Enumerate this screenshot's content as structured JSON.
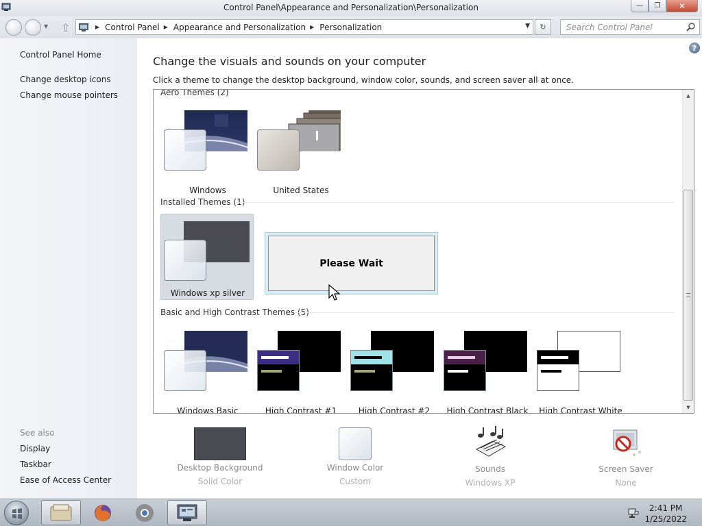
{
  "window": {
    "title": "Control Panel\\Appearance and Personalization\\Personalization",
    "minimize_glyph": "—",
    "maximize_glyph": "❐",
    "close_glyph": "✕"
  },
  "nav": {
    "breadcrumb": [
      "Control Panel",
      "Appearance and Personalization",
      "Personalization"
    ],
    "search_placeholder": "Search Control Panel"
  },
  "sidebar": {
    "links": [
      "Control Panel Home",
      "Change desktop icons",
      "Change mouse pointers"
    ],
    "see_also_label": "See also",
    "see_also": [
      "Display",
      "Taskbar",
      "Ease of Access Center"
    ]
  },
  "main": {
    "heading": "Change the visuals and sounds on your computer",
    "subheading": "Click a theme to change the desktop background, window color, sounds, and screen saver all at once.",
    "help_glyph": "?"
  },
  "groups": {
    "aero": "Aero Themes (2)",
    "installed": "Installed Themes (1)",
    "basic": "Basic and High Contrast Themes (5)"
  },
  "themes": {
    "aero": [
      "Windows",
      "United States"
    ],
    "installed": [
      "Windows xp silver"
    ],
    "basic": [
      "Windows Basic",
      "High Contrast #1",
      "High Contrast #2",
      "High Contrast Black",
      "High Contrast White"
    ]
  },
  "dialog": {
    "please_wait": "Please Wait"
  },
  "bottom": [
    {
      "label": "Desktop Background",
      "sub": "Solid Color"
    },
    {
      "label": "Window Color",
      "sub": "Custom"
    },
    {
      "label": "Sounds",
      "sub": "Windows XP"
    },
    {
      "label": "Screen Saver",
      "sub": "None"
    }
  ],
  "taskbar": {
    "time": "2:41 PM",
    "date": "1/25/2022"
  }
}
